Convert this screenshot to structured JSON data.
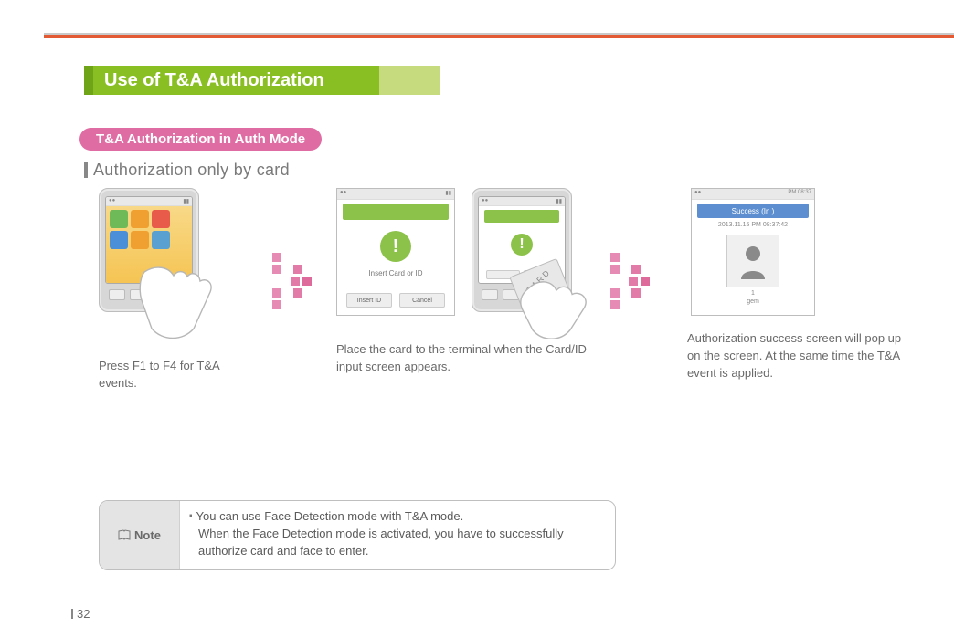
{
  "header": {
    "title": "Use of T&A Authorization"
  },
  "subtitle": "T&A Authorization in Auth Mode",
  "section_heading": "Authorization only by card",
  "steps": {
    "step1": {
      "caption": "Press F1 to F4 for T&A events."
    },
    "step2": {
      "caption": "Place the card to the terminal when the Card/ID input  screen appears.",
      "screen_prompt": "Insert Card or ID",
      "button_left": "Insert ID",
      "button_right": "Cancel",
      "card_label": "CARD"
    },
    "step3": {
      "caption": "Authorization success screen will pop up on the screen. At the same time the T&A event is applied.",
      "success_label": "Success (In )",
      "success_date": "2013.11.15 PM 08:37:42",
      "user_id": "1",
      "user_name": "gem"
    }
  },
  "note": {
    "label": "Note",
    "line1": "You can use Face Detection mode with T&A mode.",
    "line2": "When the Face Detection mode is activated, you have to successfully authorize card and face to enter."
  },
  "page_number": "32"
}
